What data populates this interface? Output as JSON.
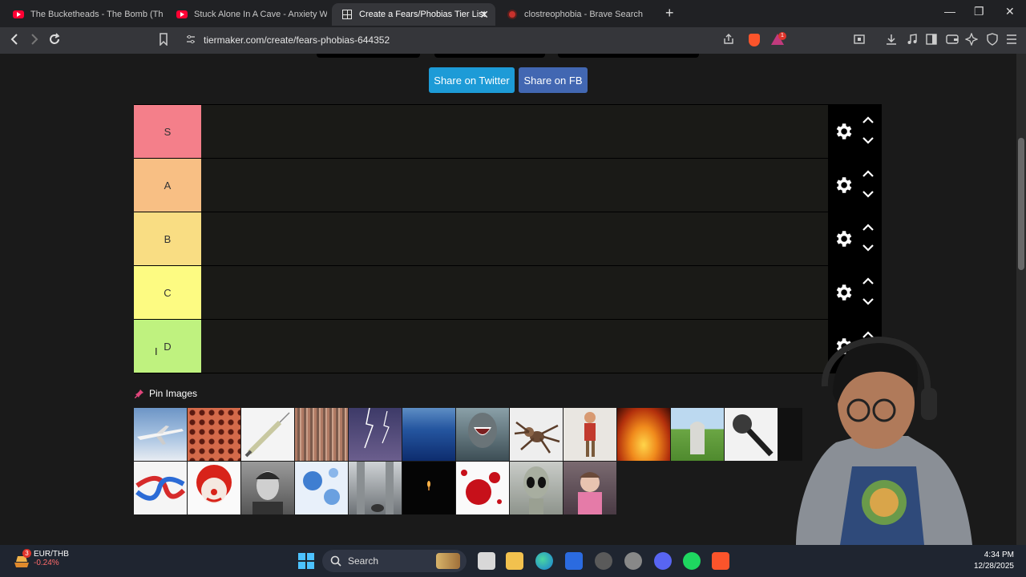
{
  "browser": {
    "tabs": [
      {
        "title": "The Bucketheads - The Bomb (These",
        "icon": "youtube-icon"
      },
      {
        "title": "Stuck Alone In A Cave - Anxiety Warr",
        "icon": "youtube-icon"
      },
      {
        "title": "Create a Fears/Phobias Tier List",
        "icon": "tiermaker-icon",
        "active": true
      },
      {
        "title": "clostreophobia - Brave Search",
        "icon": "brave-search-icon"
      }
    ],
    "url": "tiermaker.com/create/fears-phobias-644352",
    "rewards_badge": "1"
  },
  "page": {
    "share_twitter": "Share on Twitter",
    "share_fb": "Share on FB",
    "tiers": [
      {
        "label": "S",
        "color": "#f47f8a"
      },
      {
        "label": "A",
        "color": "#f8bf84"
      },
      {
        "label": "B",
        "color": "#f9dd83"
      },
      {
        "label": "C",
        "color": "#fdfb82"
      },
      {
        "label": "D",
        "color": "#bff27f"
      }
    ],
    "pin_label": "Pin Images",
    "images": [
      "airplane",
      "lotus-seed-holes",
      "syringe",
      "crowd",
      "lightning",
      "deep-ocean",
      "shark",
      "spider",
      "puppet",
      "fire",
      "grave",
      "microphone",
      "partial-image",
      "knot",
      "clown",
      "portrait",
      "virus",
      "height-view",
      "candle-in-dark",
      "blood",
      "alien",
      "screaming-girl"
    ]
  },
  "taskbar": {
    "ticker_symbol": "EUR/THB",
    "ticker_change": "-0.24%",
    "ticker_badge": "3",
    "search_label": "Search",
    "time": "4:34 PM",
    "date": "12/28/2025"
  }
}
